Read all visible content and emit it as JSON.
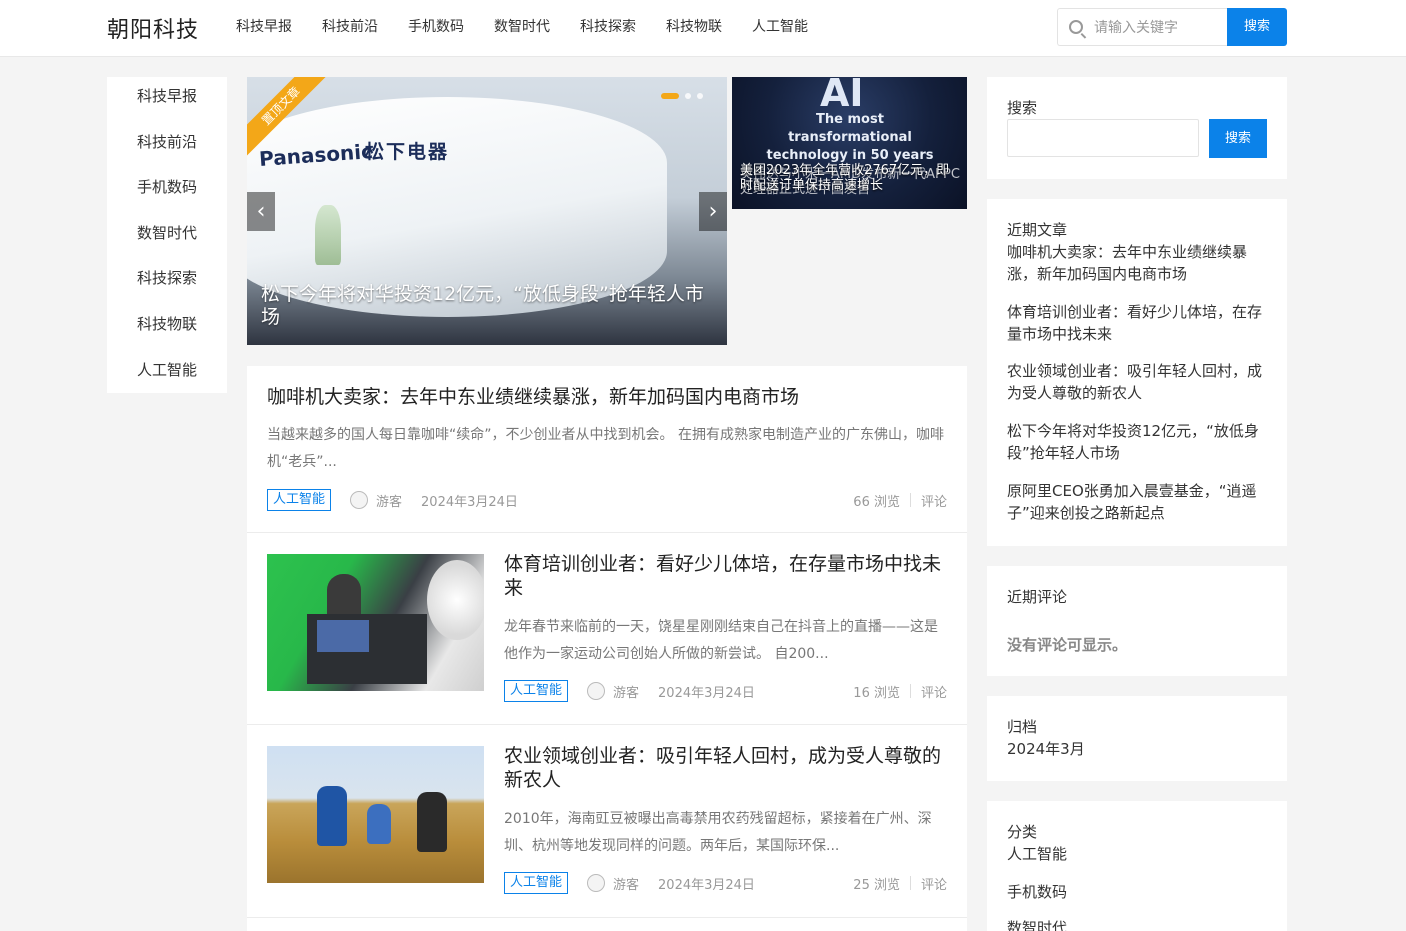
{
  "site": {
    "logo": "朝阳科技"
  },
  "topnav": [
    "科技早报",
    "科技前沿",
    "手机数码",
    "数智时代",
    "科技探索",
    "科技物联",
    "人工智能"
  ],
  "header_search": {
    "placeholder": "请输入关键字",
    "button": "搜索"
  },
  "leftmenu": [
    "科技早报",
    "科技前沿",
    "手机数码",
    "数智时代",
    "科技探索",
    "科技物联",
    "人工智能"
  ],
  "slider": {
    "ribbon": "置顶文章",
    "brand_en": "Panasonic",
    "brand_cn": "松下电器",
    "title": "松下今年将对华投资12亿元，“放低身段”抢年轻人市场"
  },
  "sidepic": {
    "ai_text": "AI",
    "tagline": "The most transformational technology in 50 years",
    "caption_front": "美团2023年全年营收2767亿元，即时配送订单保持高速增长",
    "caption_back": "英伟达与小米一AMD发布新一代AI PC处理器正式进中国发售"
  },
  "posts": [
    {
      "title": "咖啡机大卖家：去年中东业绩继续暴涨，新年加码国内电商市场",
      "excerpt": "当越来越多的国人每日靠咖啡“续命”，不少创业者从中找到机会。 在拥有成熟家电制造产业的广东佛山，咖啡机“老兵”...",
      "category": "人工智能",
      "author": "游客",
      "date": "2024年3月24日",
      "views": "66 浏览",
      "comments": "评论"
    },
    {
      "title": "体育培训创业者：看好少儿体培，在存量市场中找未来",
      "excerpt": "龙年春节来临前的一天，饶星星刚刚结束自己在抖音上的直播——这是他作为一家运动公司创始人所做的新尝试。 自200...",
      "category": "人工智能",
      "author": "游客",
      "date": "2024年3月24日",
      "views": "16 浏览",
      "comments": "评论"
    },
    {
      "title": "农业领域创业者：吸引年轻人回村，成为受人尊敬的新农人",
      "excerpt": "2010年，海南豇豆被曝出高毒禁用农药残留超标，紧接着在广州、深圳、杭州等地发现同样的问题。两年后，某国际环保...",
      "category": "人工智能",
      "author": "游客",
      "date": "2024年3月24日",
      "views": "25 浏览",
      "comments": "评论"
    }
  ],
  "sidebar": {
    "search": {
      "title": "搜索",
      "button": "搜索",
      "placeholder": ""
    },
    "recent_posts": {
      "title": "近期文章",
      "items": [
        "咖啡机大卖家：去年中东业绩继续暴涨，新年加码国内电商市场",
        "体育培训创业者：看好少儿体培，在存量市场中找未来",
        "农业领域创业者：吸引年轻人回村，成为受人尊敬的新农人",
        "松下今年将对华投资12亿元，“放低身段”抢年轻人市场",
        "原阿里CEO张勇加入晨壹基金，“逍遥子”迎来创投之路新起点"
      ]
    },
    "recent_comments": {
      "title": "近期评论",
      "empty": "没有评论可显示。"
    },
    "archives": {
      "title": "归档",
      "items": [
        "2024年3月"
      ]
    },
    "categories": {
      "title": "分类",
      "items": [
        "人工智能",
        "手机数码",
        "数智时代"
      ]
    }
  },
  "colors": {
    "accent": "#0b82e9",
    "ribbon": "#f3a718"
  }
}
